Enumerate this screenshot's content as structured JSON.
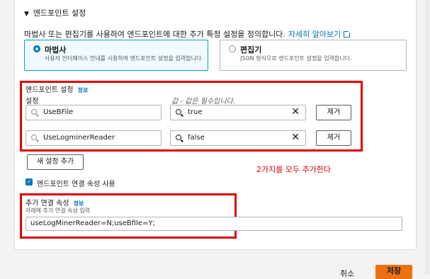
{
  "section": {
    "caret": "▼",
    "title": "엔드포인트 설정",
    "description": "마법사 또는 편집기를 사용하여 엔드포인트에 대한 추가 특정 설정을 정의합니다.",
    "learn_more": "자세히 알아보기"
  },
  "mode_options": [
    {
      "title": "마법사",
      "desc": "사용자 인터페이스 안내를 사용하여 엔드포인트 설정을 입력합니다.",
      "selected": true
    },
    {
      "title": "편집기",
      "desc": "JSON 형식으로 엔드포인트 설정을 입력합니다.",
      "selected": false
    }
  ],
  "endpoint_settings": {
    "title": "엔드포인트 설정",
    "info": "정보",
    "key_label": "설정",
    "value_hint": "값 - 값은 필수입니다.",
    "rows": [
      {
        "key": "UseBFile",
        "value": "true",
        "remove": "제거"
      },
      {
        "key": "UseLogminerReader",
        "value": "false",
        "remove": "제거"
      }
    ],
    "add_button": "새 설정 추가"
  },
  "annotation": "2가지를 모두 추가한다",
  "connection_attr": {
    "checkbox_label": "엔드포인트 연결 속성 사용",
    "checked": true,
    "title": "추가 연결 속성",
    "info": "정보",
    "hint": "아래에 추가 연결 속성 입력",
    "value": "useLogMinerReader=N;useBfile=Y;"
  },
  "footer": {
    "cancel": "취소",
    "save": "저장"
  },
  "colors": {
    "accent": "#0073bb",
    "highlight": "#e00000",
    "primary_button": "#ec7211"
  },
  "icons": {
    "search": "search-icon",
    "clear": "clear-icon",
    "external": "external-link-icon",
    "checkbox": "checkbox-checked-icon"
  }
}
